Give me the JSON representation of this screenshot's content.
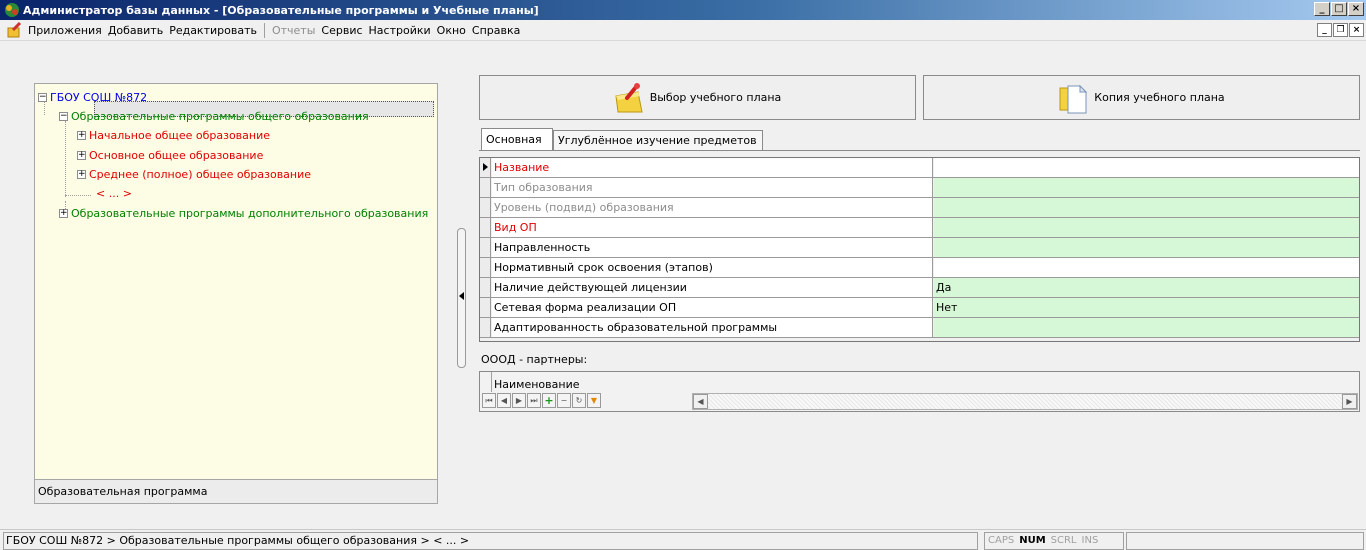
{
  "window": {
    "title": "Администратор базы данных - [Образовательные программы и Учебные планы]",
    "min_glyph": "_",
    "max_glyph": "□",
    "close_glyph": "×",
    "restore_glyph": "❐"
  },
  "menu": {
    "items": [
      {
        "label": "Приложения",
        "enabled": true
      },
      {
        "label": "Добавить",
        "enabled": true
      },
      {
        "label": "Редактировать",
        "enabled": true
      },
      {
        "label": "Отчеты",
        "enabled": false
      },
      {
        "label": "Сервис",
        "enabled": true
      },
      {
        "label": "Настройки",
        "enabled": true
      },
      {
        "label": "Окно",
        "enabled": true
      },
      {
        "label": "Справка",
        "enabled": true
      }
    ]
  },
  "tree": {
    "root": "ГБОУ СОШ №872",
    "general": "Образовательные программы общего образования",
    "primary": "Начальное общее образование",
    "basic": "Основное общее образование",
    "secondary": "Среднее (полное) общее образование",
    "placeholder": "< ... >",
    "additional": "Образовательные программы дополнительного образования",
    "footer": "Образовательная программа",
    "expanded_glyph": "−",
    "collapsed_glyph": "+"
  },
  "buttons": {
    "plan": "Выбор учебного плана",
    "copy": "Копия учебного плана"
  },
  "tabs": {
    "main": "Основная",
    "deep": "Углублённое изучение предметов"
  },
  "grid": {
    "rows": [
      {
        "label": "Название",
        "value": ""
      },
      {
        "label": "Тип образования",
        "value": ""
      },
      {
        "label": "Уровень (подвид) образования",
        "value": ""
      },
      {
        "label": "Вид ОП",
        "value": ""
      },
      {
        "label": "Направленность",
        "value": ""
      },
      {
        "label": "Нормативный срок освоения (этапов)",
        "value": ""
      },
      {
        "label": "Наличие действующей лицензии",
        "value": "Да"
      },
      {
        "label": "Сетевая форма реализации ОП",
        "value": "Нет"
      },
      {
        "label": "Адаптированность образовательной программы",
        "value": ""
      }
    ]
  },
  "partners": {
    "label": "ОООД - партнеры:",
    "column": "Наименование",
    "nav": {
      "first": "⏮",
      "prev": "◀",
      "next": "▶",
      "last": "⏭",
      "add": "+",
      "remove": "−",
      "refresh": "↻",
      "filter": "▼",
      "scroll_left": "◀",
      "scroll_right": "▶"
    }
  },
  "status": {
    "path": "ГБОУ СОШ №872 > Образовательные программы общего образования > < ... >",
    "caps": "CAPS",
    "num": "NUM",
    "scrl": "SCRL",
    "ins": "INS"
  },
  "colors": {
    "required_label": "#e00000",
    "disabled_label": "#8c8c8c",
    "editable_value": "#d6f8d6",
    "tree_root": "#0000e6",
    "tree_group": "#008000",
    "tree_leaf": "#e00000",
    "tree_background": "#fdfde6"
  }
}
